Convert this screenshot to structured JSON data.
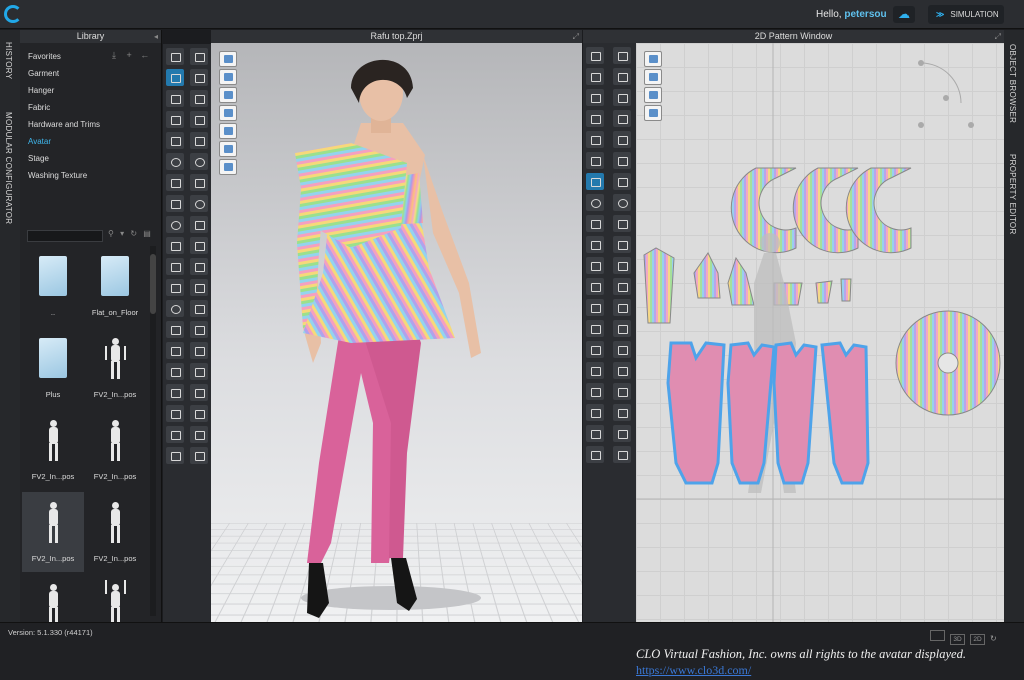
{
  "topbar": {
    "greeting": "Hello,",
    "username": "petersou",
    "simulation_label": "SIMULATION"
  },
  "left_tabs": [
    "HISTORY",
    "MODULAR CONFIGURATOR"
  ],
  "right_tabs": [
    "OBJECT BROWSER",
    "PROPERTY EDITOR"
  ],
  "library": {
    "title": "Library",
    "items": [
      "Favorites",
      "Garment",
      "Hanger",
      "Fabric",
      "Hardware and Trims",
      "Avatar",
      "Stage",
      "Washing Texture"
    ],
    "active_item": "Avatar",
    "thumbnails": [
      {
        "label": "..",
        "kind": "folder"
      },
      {
        "label": "Flat_on_Floor",
        "kind": "folder"
      },
      {
        "label": "Plus",
        "kind": "folder"
      },
      {
        "label": "FV2_In...pos",
        "kind": "figure"
      },
      {
        "label": "FV2_In...pos",
        "kind": "figure"
      },
      {
        "label": "FV2_In...pos",
        "kind": "figure"
      },
      {
        "label": "FV2_In...pos",
        "kind": "figure"
      },
      {
        "label": "FV2_In...pos",
        "kind": "figure"
      },
      {
        "label": "",
        "kind": "figure"
      },
      {
        "label": "",
        "kind": "figure"
      }
    ]
  },
  "view3d": {
    "title": "Rafu top.Zprj"
  },
  "view2d": {
    "title": "2D Pattern Window"
  },
  "status": {
    "version": "Version: 5.1.330 (r44171)",
    "view_modes": [
      "",
      "3D",
      "2D"
    ]
  },
  "footer": {
    "copyright": "CLO Virtual Fashion, Inc. owns all rights to the avatar displayed.",
    "link": "https://www.clo3d.com/"
  },
  "colors": {
    "accent": "#21a8e8",
    "pants": "#d9629a",
    "panel_bg": "#232427"
  }
}
